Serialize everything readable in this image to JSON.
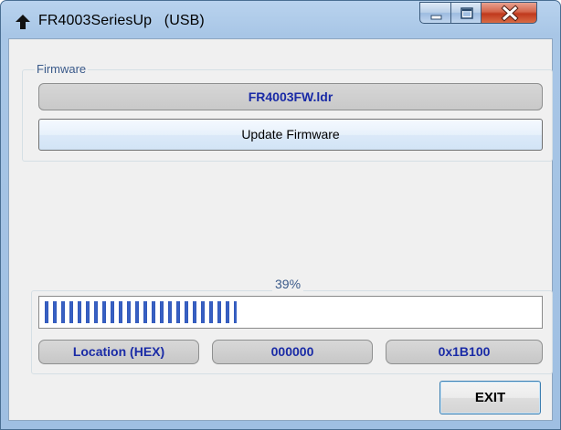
{
  "window": {
    "title": "FR4003SeriesUp   (USB)",
    "app_icon": "up-arrow-icon",
    "controls": {
      "minimize_icon": "minimize-icon",
      "maximize_icon": "maximize-icon",
      "close_icon": "close-icon"
    }
  },
  "firmware_group": {
    "label": "Firmware",
    "file_name": "FR4003FW.ldr",
    "update_button": "Update Firmware"
  },
  "progress": {
    "percent_text": "39%",
    "fraction": 0.39,
    "segments_color": "#2f55b5"
  },
  "location": {
    "label": "Location (HEX)",
    "value": "000000",
    "size": "0x1B100"
  },
  "exit_button": "EXIT",
  "colors": {
    "field_text": "#1a2ba6",
    "group_label": "#3a5a8a",
    "titlebar": "#a8c6e6",
    "close_button": "#c0391d"
  }
}
